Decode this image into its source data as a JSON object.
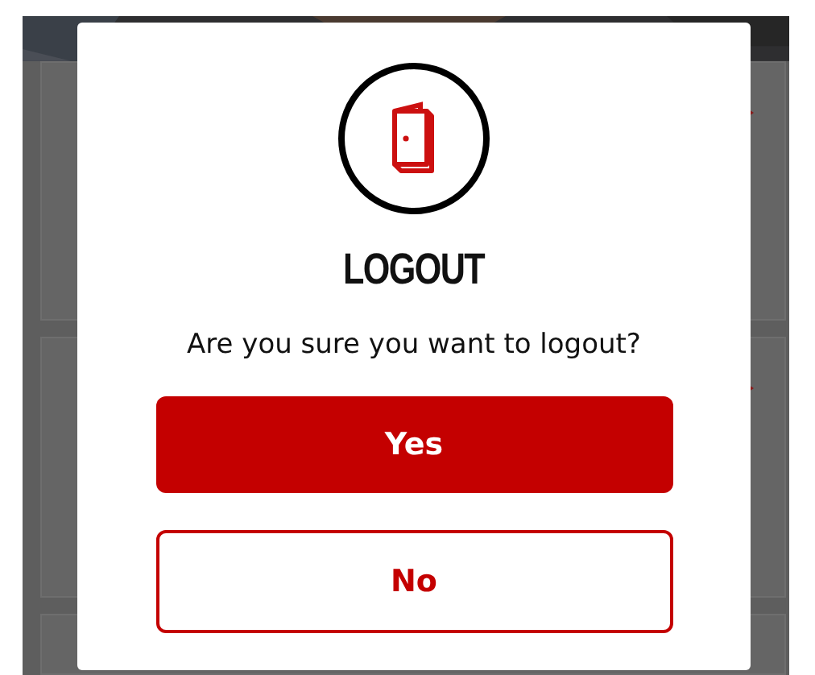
{
  "background_cards": [
    {
      "kind": "card"
    },
    {
      "kind": "card"
    }
  ],
  "dialog": {
    "title": "LOGOUT",
    "message": "Are you sure you want to logout?",
    "buttons": [
      {
        "label": "Yes",
        "kind": "primary"
      },
      {
        "label": "No",
        "kind": "secondary"
      }
    ]
  }
}
